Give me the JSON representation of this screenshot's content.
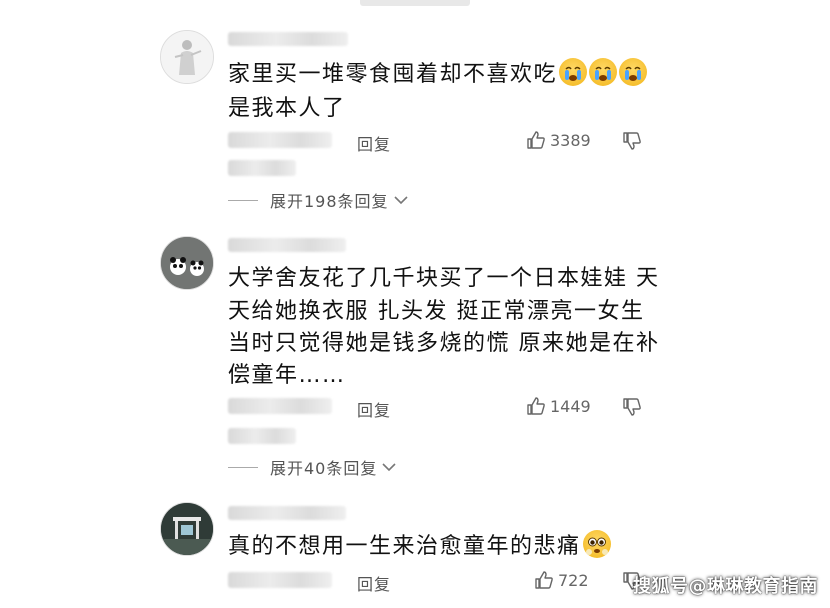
{
  "comments": [
    {
      "lines": [
        "家里买一堆零食囤着却不喜欢吃",
        "是我本人了"
      ],
      "reply_label": "回复",
      "likes": "3389",
      "expand_label": "展开198条回复",
      "emojis": [
        "crying-face",
        "crying-face",
        "crying-face"
      ]
    },
    {
      "lines": [
        "大学舍友花了几千块买了一个日本娃娃 天",
        "天给她换衣服 扎头发 挺正常漂亮一女生",
        "当时只觉得她是钱多烧的慌 原来她是在补",
        "偿童年……"
      ],
      "reply_label": "回复",
      "likes": "1449",
      "expand_label": "展开40条回复"
    },
    {
      "lines": [
        "真的不想用一生来治愈童年的悲痛"
      ],
      "reply_label": "回复",
      "likes": "722",
      "emojis": [
        "pleading-face"
      ]
    }
  ],
  "watermark": "搜狐号@琳琳教育指南",
  "colors": {
    "text": "#111111",
    "secondary": "#555555",
    "emoji": "#f6c84c"
  }
}
